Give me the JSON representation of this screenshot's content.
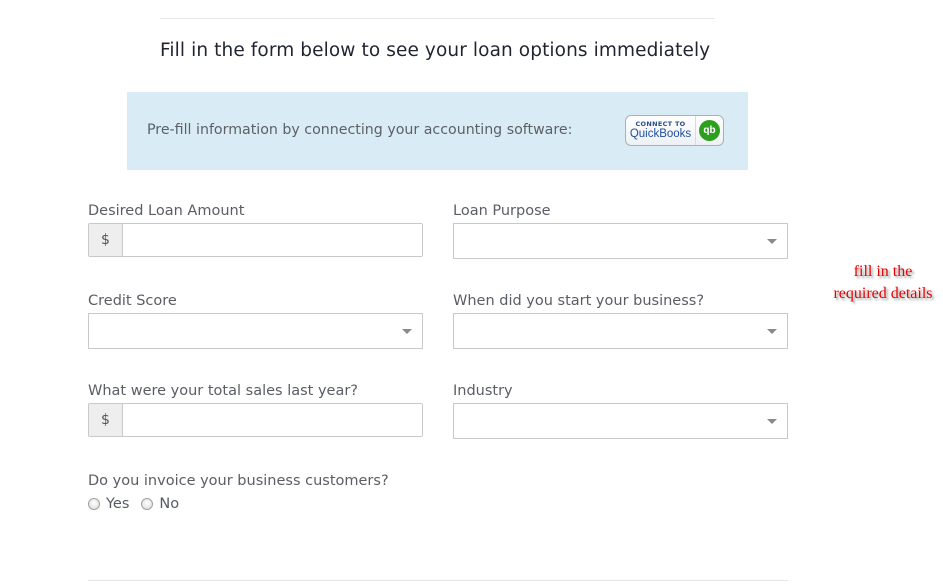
{
  "header": {
    "headline": "Fill in the form below to see your loan options immediately"
  },
  "prefill": {
    "text": "Pre-fill information by connecting your accounting software:",
    "button": {
      "connect_label": "CONNECT TO",
      "brand_label": "QuickBooks",
      "logo_glyph": "qb",
      "icon": "quickbooks-logo-icon",
      "brand_color": "#2ca01c"
    }
  },
  "form": {
    "desired_loan_amount": {
      "label": "Desired Loan Amount",
      "addon": "$",
      "value": "",
      "type": "currency-input"
    },
    "loan_purpose": {
      "label": "Loan Purpose",
      "selected": "",
      "type": "select"
    },
    "credit_score": {
      "label": "Credit Score",
      "selected": "",
      "type": "select"
    },
    "business_start": {
      "label": "When did you start your business?",
      "selected": "",
      "type": "select"
    },
    "total_sales": {
      "label": "What were your total sales last year?",
      "addon": "$",
      "value": "",
      "type": "currency-input"
    },
    "industry": {
      "label": "Industry",
      "selected": "",
      "type": "select"
    },
    "invoice_customers": {
      "label": "Do you invoice your business customers?",
      "options": [
        {
          "label": "Yes",
          "checked": false
        },
        {
          "label": "No",
          "checked": false
        }
      ]
    }
  },
  "annotation": {
    "line1": "fill in the",
    "line2": "required details",
    "color": "#e60000"
  }
}
